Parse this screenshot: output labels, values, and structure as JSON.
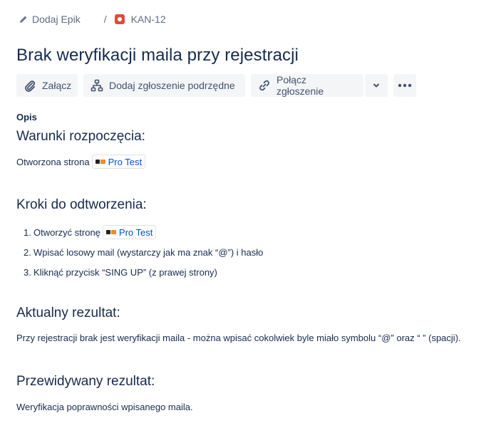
{
  "breadcrumb": {
    "epic_label": "Dodaj Epik",
    "separator": "/",
    "issue_key": "KAN-12"
  },
  "issue": {
    "title": "Brak weryfikacji maila przy rejestracji"
  },
  "toolbar": {
    "attach_label": "Załącz",
    "add_child_label": "Dodaj zgłoszenie podrzędne",
    "link_issue_label": "Połącz zgłoszenie"
  },
  "description": {
    "label": "Opis",
    "preconditions": {
      "heading": "Warunki rozpoczęcia:",
      "text": "Otworzona strona",
      "link_text": "Pro Test"
    },
    "steps": {
      "heading": "Kroki do odtworzenia:",
      "items": [
        {
          "num": "1.",
          "text": "Otworzyć stronę",
          "link_text": "Pro Test"
        },
        {
          "num": "2.",
          "text": "Wpisać losowy mail (wystarczy jak ma znak “@”) i hasło"
        },
        {
          "num": "3.",
          "text": "Kliknąć przycisk “SING UP” (z prawej strony)"
        }
      ]
    },
    "actual": {
      "heading": "Aktualny rezultat:",
      "text": "Przy rejestracji brak jest weryfikacji maila - można wpisać cokolwiek byle miało symbolu “@” oraz “ ” (spacji)."
    },
    "expected": {
      "heading": "Przewidywany rezultat:",
      "text": "Weryfikacja poprawności wpisanego maila."
    }
  }
}
